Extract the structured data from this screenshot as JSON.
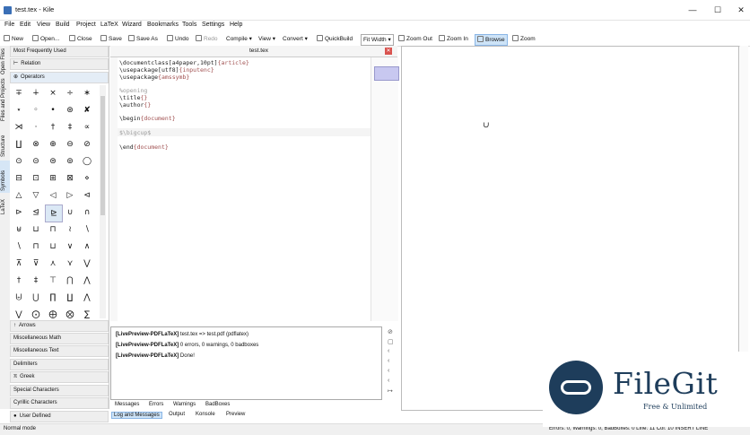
{
  "window": {
    "title": "test.tex - Kile",
    "minimize": "—",
    "maximize": "☐",
    "close": "✕"
  },
  "menu": [
    "File",
    "Edit",
    "View",
    "Build",
    "Project",
    "LaTeX",
    "Wizard",
    "Bookmarks",
    "Tools",
    "Settings",
    "Help"
  ],
  "toolbar": {
    "new": "New",
    "open": "Open...",
    "close": "Close",
    "save": "Save",
    "save_as": "Save As",
    "undo": "Undo",
    "redo": "Redo",
    "compile": "Compile",
    "view": "View",
    "convert": "Convert",
    "quickbuild": "QuickBuild",
    "fit_width": "Fit Width",
    "zoom_out": "Zoom Out",
    "zoom_in": "Zoom In",
    "browse": "Browse",
    "zoom": "Zoom"
  },
  "side_tabs": [
    "Open Files",
    "Files and Projects",
    "Structure",
    "Symbols",
    "LaTeX"
  ],
  "symbols": {
    "top_sections": [
      "Most Frequently Used",
      "Relation",
      "Operators"
    ],
    "grid": [
      "∓",
      "∔",
      "×",
      "÷",
      "∗",
      "⋆",
      "◦",
      "•",
      "⊛",
      "✘",
      "⋊",
      "·",
      "†",
      "‡",
      "∝",
      "∐",
      "⊗",
      "⊕",
      "⊖",
      "⊘",
      "⊙",
      "⊝",
      "⊜",
      "⊚",
      "◯",
      "⊟",
      "⊡",
      "⊞",
      "⊠",
      "⋄",
      "△",
      "▽",
      "◁",
      "▷",
      "⊲",
      "⊳",
      "⊴",
      "⊵",
      "∪",
      "∩",
      "⊎",
      "⊔",
      "⊓",
      "≀",
      "∖",
      "∖",
      "⊓",
      "⊔",
      "∨",
      "∧",
      "⊼",
      "⊽",
      "⋏",
      "⋎",
      "⋁",
      "†",
      "‡",
      "⊤",
      "⋂",
      "⋀",
      "⨄",
      "⋃",
      "∏",
      "∐",
      "⋀",
      "⋁",
      "⨀",
      "⨁",
      "⨂",
      "∑"
    ],
    "bottom_sections": [
      "Arrows",
      "Miscellaneous Math",
      "Miscellaneous Text",
      "Delimiters",
      "Greek",
      "Special Characters",
      "Cyrillic Characters",
      "User Defined"
    ]
  },
  "editor": {
    "tab_name": "test.tex",
    "lines": [
      {
        "cmd": "\\documentclass",
        "opt": "[a4paper,10pt]",
        "arg": "{article}"
      },
      {
        "cmd": "\\usepackage",
        "opt": "[utf8]",
        "arg": "{inputenc}"
      },
      {
        "cmd": "\\usepackage",
        "opt": "",
        "arg": "{amssymb}"
      },
      {
        "cmd": "",
        "opt": "",
        "arg": ""
      },
      {
        "cmd": "%opening",
        "opt": "",
        "arg": "",
        "comment": true
      },
      {
        "cmd": "\\title",
        "opt": "",
        "arg": "{}"
      },
      {
        "cmd": "\\author",
        "opt": "",
        "arg": "{}"
      },
      {
        "cmd": "",
        "opt": "",
        "arg": ""
      },
      {
        "cmd": "\\begin",
        "opt": "",
        "arg": "{document}"
      },
      {
        "cmd": "",
        "opt": "",
        "arg": ""
      },
      {
        "cmd": "$\\bigcup$",
        "opt": "",
        "arg": "",
        "comment": true
      },
      {
        "cmd": "",
        "opt": "",
        "arg": ""
      },
      {
        "cmd": "\\end",
        "opt": "",
        "arg": "{document}"
      }
    ]
  },
  "preview": {
    "glyph": "∪"
  },
  "log": {
    "lines": [
      {
        "source": "[LivePreview-PDFLaTeX]",
        "text": " test.tex => test.pdf (pdflatex)"
      },
      {
        "source": "[LivePreview-PDFLaTeX]",
        "text": " 0 errors, 0 warnings, 0 badboxes"
      },
      {
        "source": "[LivePreview-PDFLaTeX]",
        "text": " Done!"
      }
    ],
    "tabs": [
      "Messages",
      "Errors",
      "Warnings",
      "BadBoxes"
    ]
  },
  "bottom_tabs": [
    "Log and Messages",
    "Output",
    "Konsole",
    "Preview"
  ],
  "status": {
    "left": "Normal mode",
    "right": "Errors: 0, Warnings: 0, BadBoxes: 0     Line: 11 Col: 10  INSERT  LINE"
  },
  "watermark": {
    "title": "FileGit",
    "subtitle": "Free & Unlimited"
  },
  "colors": {
    "accent": "#3a6fb6",
    "selection": "#cde3f7",
    "watermark": "#1e3d5b"
  }
}
